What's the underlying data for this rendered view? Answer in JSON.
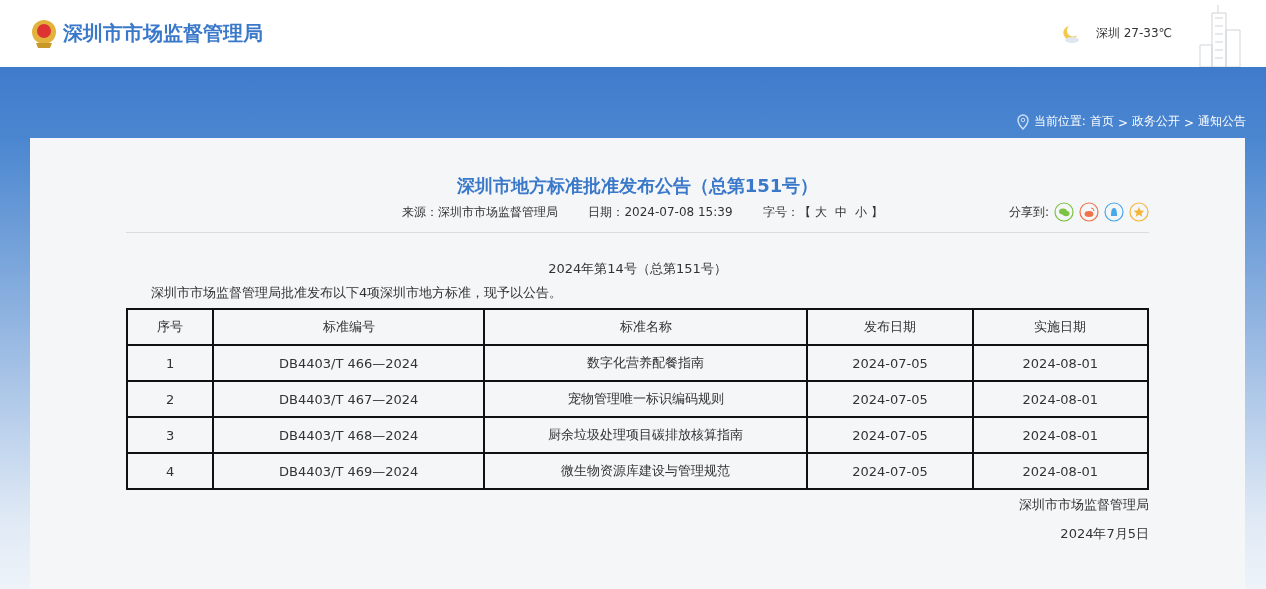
{
  "header": {
    "site_name": "深圳市市场监督管理局",
    "weather": "深圳 27-33℃"
  },
  "breadcrumb": {
    "label": "当前位置:",
    "separator": ">",
    "items": [
      "首页",
      "政务公开",
      "通知公告"
    ]
  },
  "article": {
    "title": "深圳市地方标准批准发布公告（总第151号）",
    "meta": {
      "source": "来源：深圳市市场监督管理局",
      "date": "日期：2024-07-08 15:39",
      "font_label": "字号：",
      "font_open": "【",
      "font_sizes": [
        "大",
        "中",
        "小"
      ],
      "font_close": "】"
    },
    "share": {
      "label": "分享到:",
      "items": [
        {
          "kind": "wechat",
          "color": "#7cc243"
        },
        {
          "kind": "weibo",
          "color": "#f0724b"
        },
        {
          "kind": "qq",
          "color": "#4aa7e8"
        },
        {
          "kind": "star",
          "color": "#f6b335"
        }
      ]
    },
    "subtitle": "2024年第14号（总第151号）",
    "intro": "深圳市市场监督管理局批准发布以下4项深圳市地方标准，现予以公告。",
    "table": {
      "columns": [
        "序号",
        "标准编号",
        "标准名称",
        "发布日期",
        "实施日期"
      ],
      "rows": [
        [
          "1",
          "DB4403/T 466—2024",
          "数字化营养配餐指南",
          "2024-07-05",
          "2024-08-01"
        ],
        [
          "2",
          "DB4403/T 467—2024",
          "宠物管理唯一标识编码规则",
          "2024-07-05",
          "2024-08-01"
        ],
        [
          "3",
          "DB4403/T 468—2024",
          "厨余垃圾处理项目碳排放核算指南",
          "2024-07-05",
          "2024-08-01"
        ],
        [
          "4",
          "DB4403/T 469—2024",
          "微生物资源库建设与管理规范",
          "2024-07-05",
          "2024-08-01"
        ]
      ]
    },
    "signature": "深圳市市场监督管理局",
    "sign_date": "2024年7月5日"
  }
}
